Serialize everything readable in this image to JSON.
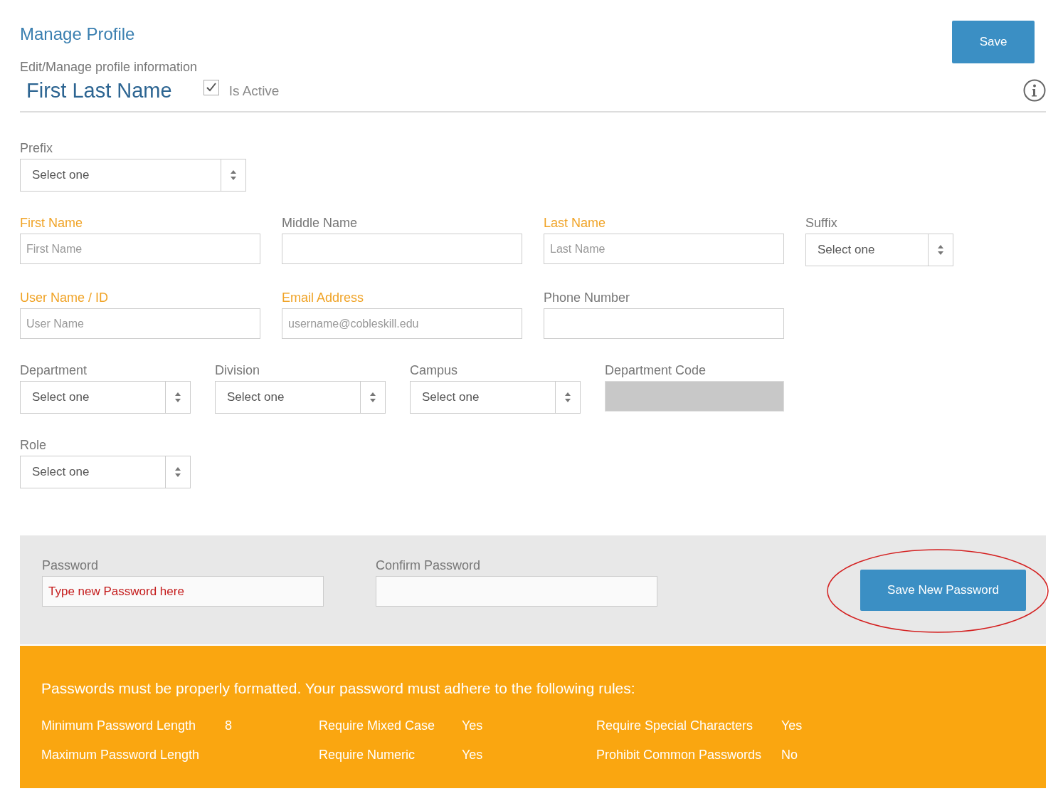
{
  "header": {
    "title": "Manage Profile",
    "subtitle": "Edit/Manage profile information",
    "name": "First Last Name",
    "active": {
      "label": "Is Active",
      "checked": true
    },
    "save_button": "Save"
  },
  "rows": [
    [
      {
        "kind": "select",
        "label": "Prefix",
        "required": false,
        "value": "Select one"
      }
    ],
    [
      {
        "kind": "text",
        "label": "First Name",
        "required": true,
        "placeholder": "First Name"
      },
      {
        "kind": "text",
        "label": "Middle Name",
        "required": false
      },
      {
        "kind": "text",
        "label": "Last Name",
        "required": true,
        "placeholder": "Last Name"
      },
      {
        "kind": "select",
        "label": "Suffix",
        "required": false,
        "value": "Select one"
      }
    ],
    [
      {
        "kind": "text",
        "label": "User Name / ID",
        "required": true,
        "placeholder": "User Name"
      },
      {
        "kind": "text",
        "label": "Email Address",
        "required": true,
        "placeholder": "username@cobleskill.edu"
      },
      {
        "kind": "text",
        "label": "Phone Number",
        "required": false
      }
    ],
    [
      {
        "kind": "select",
        "label": "Department",
        "required": false,
        "value": "Select one"
      },
      {
        "kind": "select",
        "label": "Division",
        "required": false,
        "value": "Select one"
      },
      {
        "kind": "select",
        "label": "Campus",
        "required": false,
        "value": "Select one"
      },
      {
        "kind": "disabled",
        "label": "Department Code",
        "required": false
      }
    ],
    [
      {
        "kind": "select",
        "label": "Role",
        "required": false,
        "value": "Select one"
      }
    ]
  ],
  "password": {
    "fields": [
      {
        "label": "Password",
        "placeholder": "Type new Password here"
      },
      {
        "label": "Confirm Password"
      }
    ],
    "button": "Save New Password"
  },
  "rules": {
    "intro": "Passwords must be properly formatted. Your password must adhere to the following rules:",
    "columns": [
      [
        {
          "label": "Minimum Password Length",
          "value": "8"
        },
        {
          "label": "Maximum Password Length"
        }
      ],
      [
        {
          "label": "Require Mixed Case",
          "value": "Yes"
        },
        {
          "label": "Require Numeric",
          "value": "Yes"
        }
      ],
      [
        {
          "label": "Require Special Characters",
          "value": "Yes"
        },
        {
          "label": "Prohibit Common Passwords",
          "value": "No"
        }
      ]
    ]
  }
}
